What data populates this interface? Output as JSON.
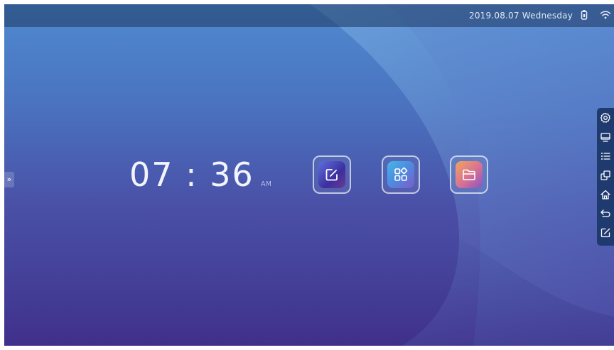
{
  "status_bar": {
    "datetime": "2019.08.07 Wednesday",
    "icons": [
      "usb-icon",
      "wifi-icon"
    ]
  },
  "clock": {
    "time": "07 : 36",
    "ampm": "AM"
  },
  "apps": [
    {
      "name": "note",
      "icon": "edit-icon"
    },
    {
      "name": "apps",
      "icon": "grid-icon"
    },
    {
      "name": "files",
      "icon": "folder-icon"
    }
  ],
  "side_toolbar": {
    "items": [
      "settings-icon",
      "display-icon",
      "list-icon",
      "window-icon",
      "home-icon",
      "back-icon",
      "annotate-icon"
    ]
  },
  "expand_tab": "»",
  "colors": {
    "toolbar": "#1e3a6e",
    "status_bar": "#1c3760",
    "bg_top": "#4f8ad0",
    "bg_bottom": "#45318f"
  }
}
